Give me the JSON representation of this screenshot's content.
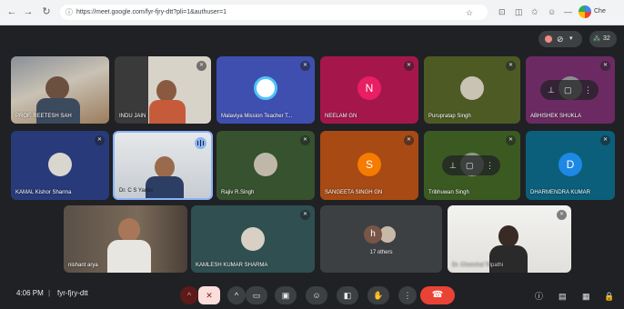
{
  "browser": {
    "url": "https://meet.google.com/fyr-fjry-dtt?pli=1&authuser=1",
    "profile_label": "Che"
  },
  "meeting": {
    "time": "4:06 PM",
    "separator": "|",
    "code": "fyr-fjry-dtt",
    "participant_count": "32"
  },
  "colors": {
    "meet_bg": "#202124",
    "control_bg": "#3c4043",
    "end_call": "#ea4335",
    "mic_off": "#f9dedc"
  },
  "participants": {
    "reetesh": "PROF. REETESH SAH",
    "indu": "INDU JAIN",
    "malaviya": "Malaviya Mission Teacher T...",
    "neelam": {
      "name": "NEELAM GN",
      "initial": "N"
    },
    "puru": "Purupratap Singh",
    "abhishek": "ABHISHEK SHUKLA",
    "kamal": "KAMAL Kishor Sharma",
    "cs": "Dr. C S Yadav",
    "rajiv": "Rajiv R.Singh",
    "sangeeta": {
      "name": "SANGEETA SINGH GN",
      "initial": "S"
    },
    "tribhuwan": "Tribhuwan Singh",
    "dharmendra": {
      "name": "DHARMENDRA KUMAR",
      "initial": "D"
    },
    "nishant": "nishant arya",
    "kamlesh": "KAMLESH KUMAR SHARMA",
    "others": {
      "label": "17 others",
      "initial": "h"
    },
    "last": "Dr. Chanchal Tripathi"
  }
}
